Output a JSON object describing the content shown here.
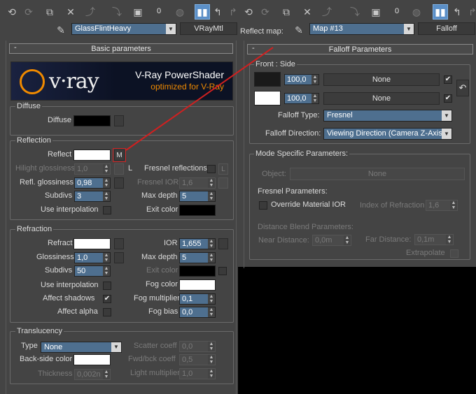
{
  "toolbar_left": {
    "zero_label": "0"
  },
  "toolbar_right": {
    "zero_label": "0"
  },
  "header": {
    "left_material_name": "GlassFlintHeavy",
    "left_material_type": "VRayMtl",
    "reflect_map_label": "Reflect map:",
    "right_map_name": "Map #13",
    "right_map_type": "Falloff"
  },
  "basic": {
    "title": "Basic parameters",
    "minus": "-",
    "banner_title": "V-Ray PowerShader",
    "banner_sub": "optimized for V-Ray",
    "logo_text": "v·ray",
    "diffuse_group": "Diffuse",
    "diffuse_label": "Diffuse",
    "reflection_group": "Reflection",
    "reflect_label": "Reflect",
    "reflect_map_btn": "M",
    "l_btn": "L",
    "hilight_label": "Hilight glossiness",
    "hilight_value": "1,0",
    "fresnel_refl_label": "Fresnel reflections",
    "fresnel_l": "L",
    "refl_gloss_label": "Refl. glossiness",
    "refl_gloss_value": "0,98",
    "fresnel_ior_label": "Fresnel IOR",
    "fresnel_ior_value": "1,6",
    "subdivs_label": "Subdivs",
    "subdivs_value": "3",
    "max_depth_label": "Max depth",
    "max_depth_value": "5",
    "use_interp_label": "Use interpolation",
    "exit_color_label": "Exit color",
    "refraction_group": "Refraction",
    "refract_label": "Refract",
    "ior_label": "IOR",
    "ior_value": "1,655",
    "glossiness_label": "Glossiness",
    "glossiness_value": "1,0",
    "rmax_depth_label": "Max depth",
    "rmax_depth_value": "5",
    "rsubdivs_label": "Subdivs",
    "rsubdivs_value": "50",
    "rexit_color_label": "Exit color",
    "ruse_interp_label": "Use interpolation",
    "fog_color_label": "Fog color",
    "affect_shadows_label": "Affect shadows",
    "fog_mult_label": "Fog multiplier",
    "fog_mult_value": "0,1",
    "affect_alpha_label": "Affect alpha",
    "fog_bias_label": "Fog bias",
    "fog_bias_value": "0,0",
    "translucency_group": "Translucency",
    "type_label": "Type",
    "type_value": "None",
    "scatter_label": "Scatter coeff",
    "scatter_value": "0,0",
    "backside_label": "Back-side color",
    "fwd_label": "Fwd/bck coeff",
    "fwd_value": "0,5",
    "thickness_label": "Thickness",
    "thickness_value": "0,002n",
    "light_mult_label": "Light multiplier",
    "light_mult_value": "1,0"
  },
  "falloff": {
    "title": "Falloff Parameters",
    "minus": "-",
    "front_side_group": "Front : Side",
    "value1": "100,0",
    "value2": "100,0",
    "none1": "None",
    "none2": "None",
    "falloff_type_label": "Falloff Type:",
    "falloff_type_value": "Fresnel",
    "falloff_dir_label": "Falloff Direction:",
    "falloff_dir_value": "Viewing Direction (Camera Z-Axis)",
    "mode_group": "Mode Specific Parameters:",
    "object_label": "Object:",
    "object_value": "None",
    "fresnel_params_label": "Fresnel Parameters:",
    "override_label": "Override Material IOR",
    "ior_label": "Index of Refraction",
    "ior_value": "1,6",
    "distance_label": "Distance Blend Parameters:",
    "near_label": "Near Distance:",
    "near_value": "0,0m",
    "far_label": "Far Distance:",
    "far_value": "0,1m",
    "extrapolate_label": "Extrapolate"
  },
  "colors": {
    "panel_bg": "#444444",
    "spinner_bg": "#4e6f8f",
    "annotation_red": "#d02020",
    "banner_orange": "#f08a00"
  }
}
